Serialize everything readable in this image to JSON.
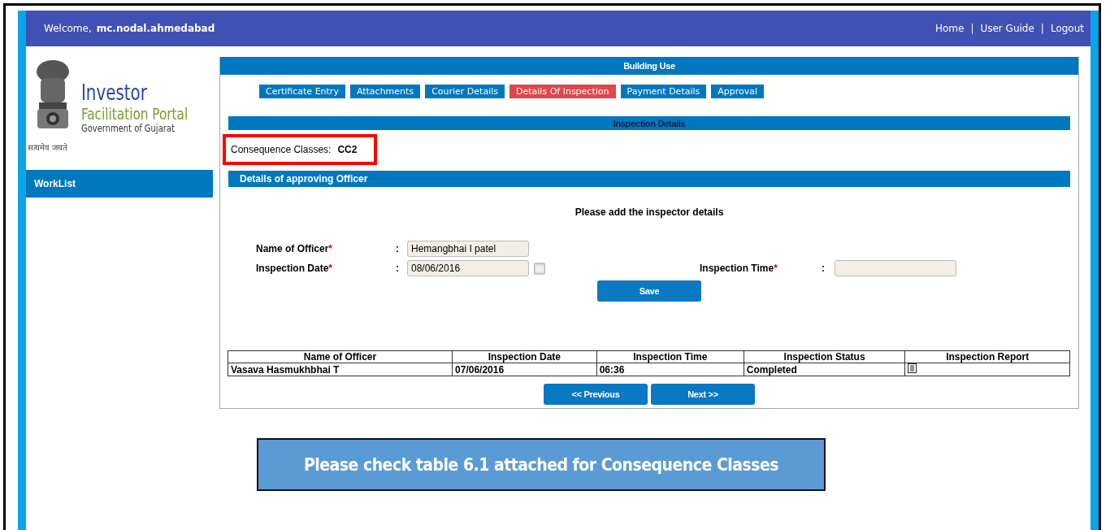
{
  "header": {
    "welcome_label": "Welcome,",
    "username": "mc.nodal.ahmedabad",
    "links": [
      "Home",
      "User Guide",
      "Logout"
    ],
    "separator": "|"
  },
  "logo": {
    "title": "Investor",
    "subtitle": "Facilitation Portal",
    "org": "Government of Gujarat",
    "motto": "सत्यमेव जयते"
  },
  "sidebar": {
    "items": [
      {
        "label": "WorkList",
        "selected": true
      }
    ]
  },
  "panel": {
    "title": "Building Use",
    "tabs": [
      {
        "label": "Certificate Entry",
        "selected": false
      },
      {
        "label": "Attachments",
        "selected": false
      },
      {
        "label": "Courier Details",
        "selected": false
      },
      {
        "label": "Details Of Inspection",
        "selected": true
      },
      {
        "label": "Payment Details",
        "selected": false
      },
      {
        "label": "Approval",
        "selected": false
      }
    ],
    "section_title": "Inspection Details",
    "consequence": {
      "label": "Consequence Classes:",
      "value": "CC2",
      "highlighted": true
    },
    "officer_section_title": "Details of approving Officer",
    "instruction": "Please add the inspector details",
    "fields": [
      {
        "label": "Name of Officer",
        "required": true,
        "value": "Hemangbhai I patel"
      },
      {
        "label": "Inspection Date",
        "required": true,
        "value": "08/06/2016"
      },
      {
        "label": "Inspection Time",
        "required": true
      }
    ],
    "required_mark": "*",
    "colon": ":",
    "save_button": "Save",
    "table": {
      "columns": [
        "Name of Officer",
        "Inspection Date",
        "Inspection Time",
        "Inspection Status",
        "Inspection Report"
      ],
      "rows": [
        {
          "cells": [
            "Vasava Hasmukhbhai T",
            "07/06/2016",
            "06:36",
            "Completed"
          ]
        }
      ]
    },
    "nav_buttons": [
      "<< Previous",
      "Next >>"
    ]
  },
  "callout": "Please check table 6.1 attached for Consequence Classes"
}
